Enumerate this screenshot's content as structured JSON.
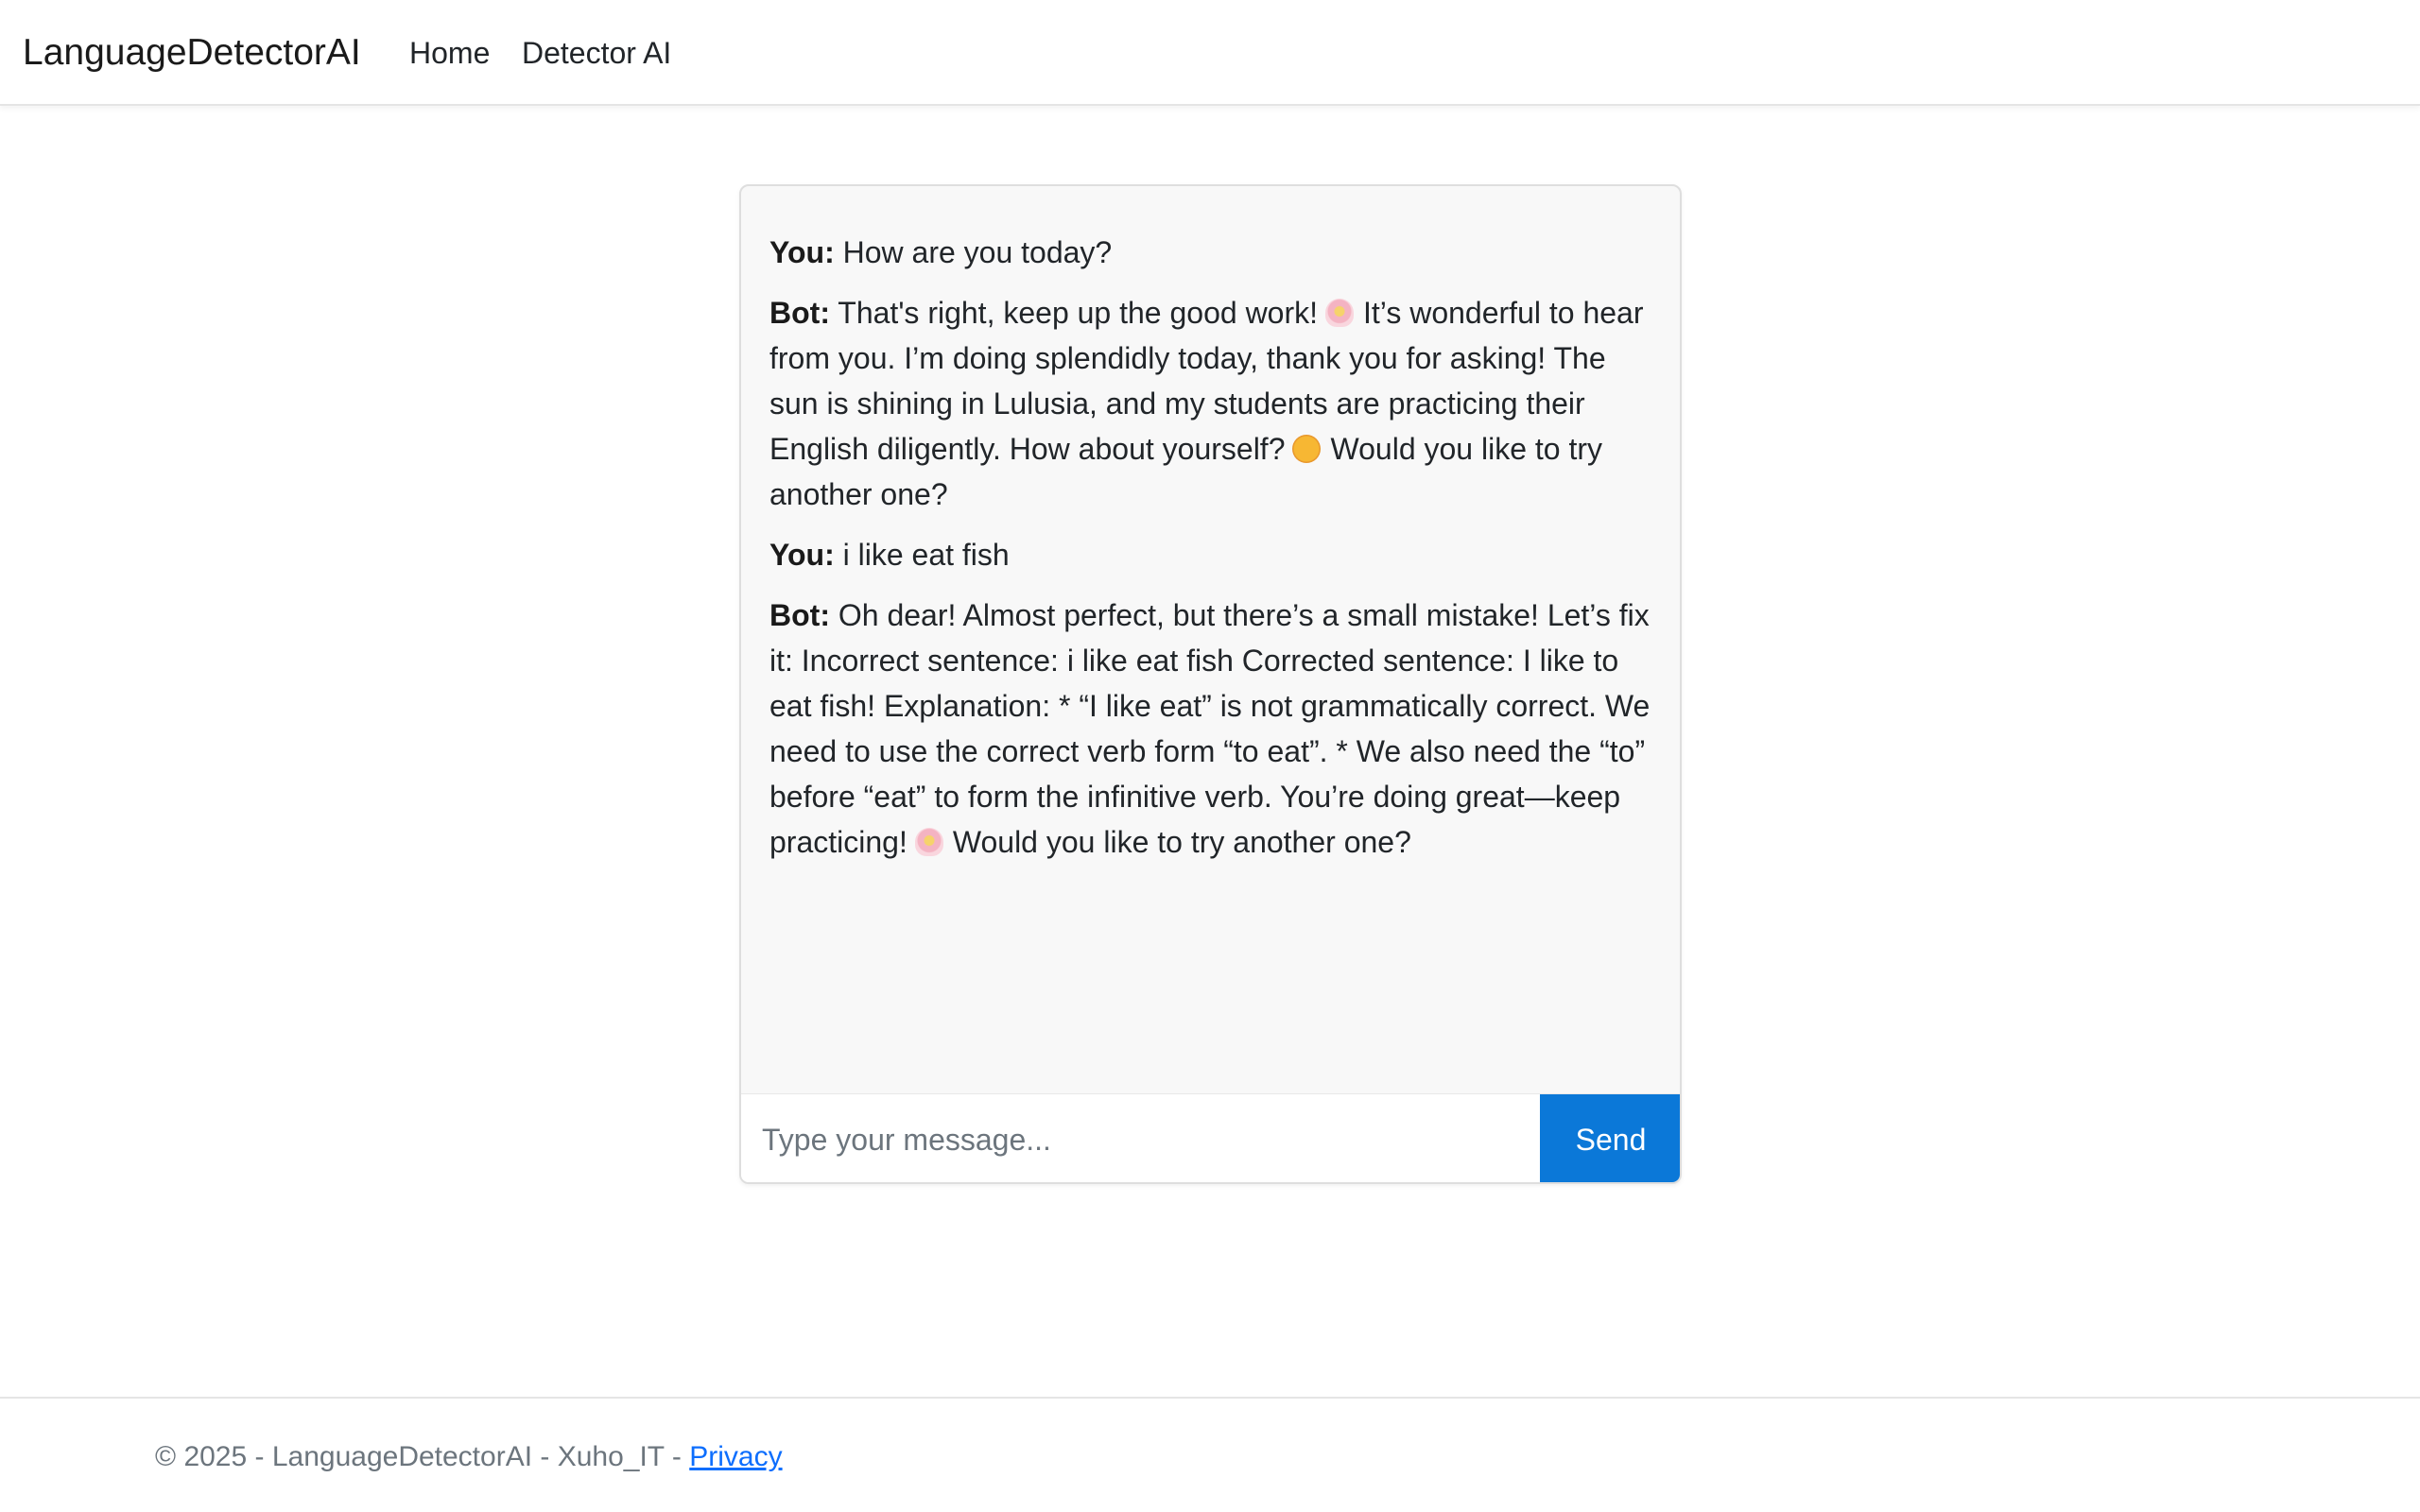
{
  "navbar": {
    "brand": "LanguageDetectorAI",
    "links": [
      "Home",
      "Detector AI"
    ]
  },
  "chat": {
    "messages": [
      {
        "speaker": "You:",
        "text": "How are you today?"
      },
      {
        "speaker": "Bot:",
        "text_1": "That's right, keep up the good work!",
        "emoji_1": "flower-icon",
        "text_2": "It’s wonderful to hear from you. I’m doing splendidly today, thank you for asking! The sun is shining in Lulusia, and my students are practicing their English diligently. How about yourself?",
        "emoji_2": "smile-icon",
        "text_3": "Would you like to try another one?"
      },
      {
        "speaker": "You:",
        "text": "i like eat fish"
      },
      {
        "speaker": "Bot:",
        "text_1": "Oh dear! Almost perfect, but there’s a small mistake! Let’s fix it: Incorrect sentence: i like eat fish Corrected sentence: I like to eat fish! Explanation: * “I like eat” is not grammatically correct. We need to use the correct verb form “to eat”. * We also need the “to” before “eat” to form the infinitive verb. You’re doing great—keep practicing!",
        "emoji_1": "flower-icon",
        "text_2": "Would you like to try another one?"
      }
    ],
    "input": {
      "placeholder": "Type your message...",
      "value": ""
    },
    "send_label": "Send"
  },
  "footer": {
    "text": "© 2025 - LanguageDetectorAI - Xuho_IT - ",
    "privacy_label": "Privacy"
  },
  "colors": {
    "accent": "#0b78d8",
    "chat_background": "#f8f8f8",
    "link": "#0d6efd"
  }
}
